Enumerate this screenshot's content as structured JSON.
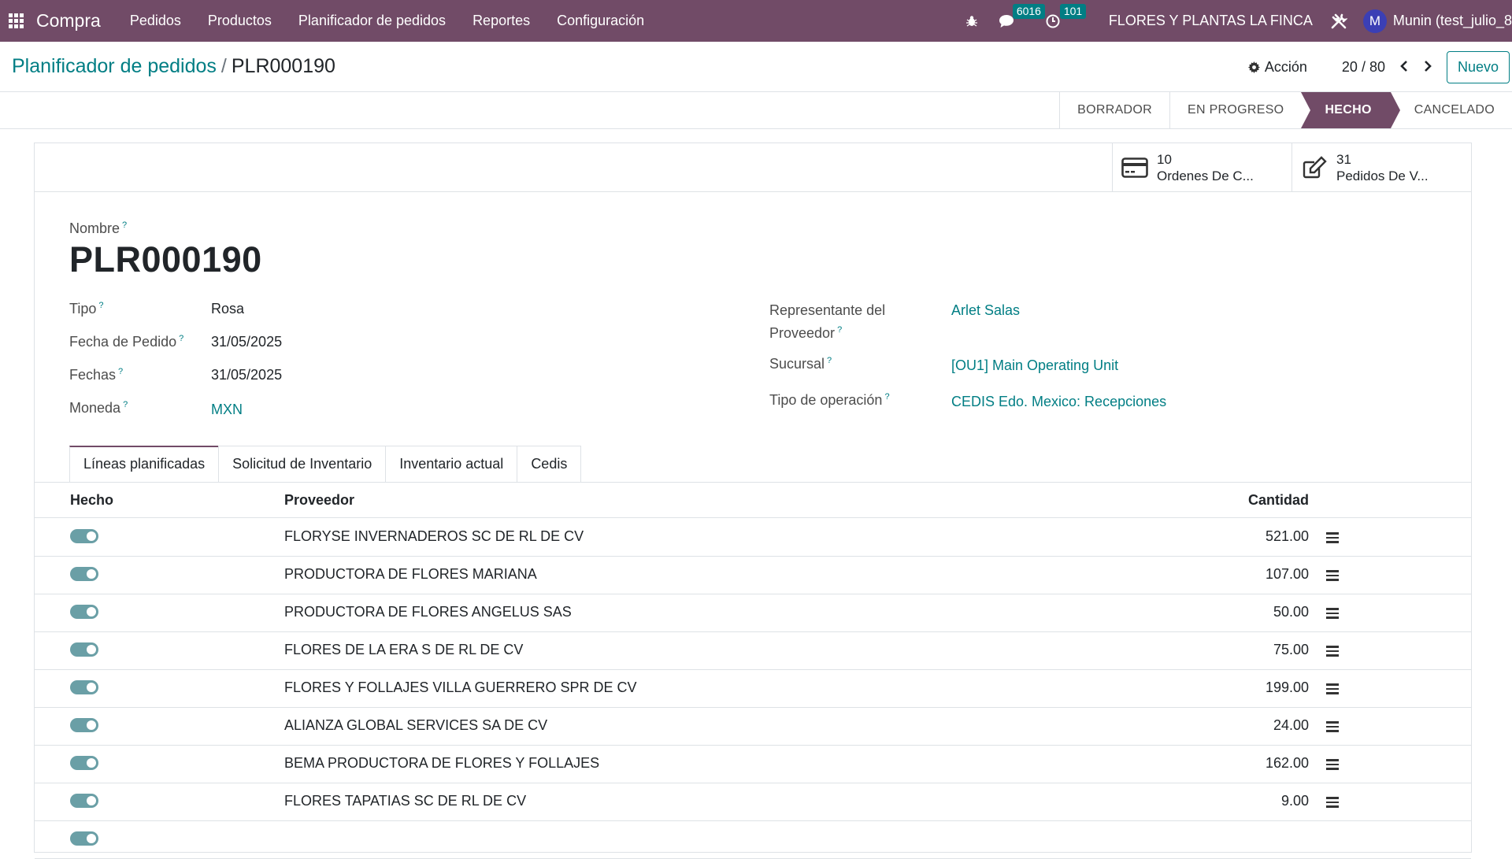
{
  "navbar": {
    "brand": "Compra",
    "menu": [
      "Pedidos",
      "Productos",
      "Planificador de pedidos",
      "Reportes",
      "Configuración"
    ],
    "messages_badge": "6016",
    "activities_badge": "101",
    "company": "FLORES Y PLANTAS LA FINCA",
    "avatar_initial": "M",
    "user": "Munin (test_julio_8"
  },
  "control_panel": {
    "breadcrumb_parent": "Planificador de pedidos",
    "breadcrumb_sep": "/",
    "breadcrumb_current": "PLR000190",
    "action_label": "Acción",
    "pager": "20 / 80",
    "new_label": "Nuevo"
  },
  "status": {
    "stages": [
      "BORRADOR",
      "EN PROGRESO",
      "HECHO",
      "CANCELADO"
    ],
    "active": "HECHO"
  },
  "smart_buttons": [
    {
      "count": "10",
      "label": "Ordenes De C..."
    },
    {
      "count": "31",
      "label": "Pedidos De V..."
    }
  ],
  "form": {
    "name_label": "Nombre",
    "name": "PLR000190",
    "tipo_label": "Tipo",
    "tipo": "Rosa",
    "fecha_pedido_label": "Fecha de Pedido",
    "fecha_pedido": "31/05/2025",
    "fechas_label": "Fechas",
    "fechas": "31/05/2025",
    "moneda_label": "Moneda",
    "moneda": "MXN",
    "representante_label_1": "Representante del",
    "representante_label_2": "Proveedor",
    "representante": "Arlet Salas",
    "sucursal_label": "Sucursal",
    "sucursal": "[OU1] Main Operating Unit",
    "tipo_operacion_label": "Tipo de operación",
    "tipo_operacion": "CEDIS Edo. Mexico: Recepciones",
    "help_mark": "?"
  },
  "tabs": [
    "Líneas planificadas",
    "Solicitud de Inventario",
    "Inventario actual",
    "Cedis"
  ],
  "table": {
    "headers": {
      "done": "Hecho",
      "supplier": "Proveedor",
      "qty": "Cantidad"
    },
    "rows": [
      {
        "supplier": "FLORYSE INVERNADEROS SC DE RL DE CV",
        "qty": "521.00",
        "done": true
      },
      {
        "supplier": "PRODUCTORA DE FLORES MARIANA",
        "qty": "107.00",
        "done": true
      },
      {
        "supplier": "PRODUCTORA DE FLORES ANGELUS SAS",
        "qty": "50.00",
        "done": true
      },
      {
        "supplier": "FLORES DE LA ERA S DE RL DE CV",
        "qty": "75.00",
        "done": true
      },
      {
        "supplier": "FLORES Y FOLLAJES VILLA GUERRERO SPR DE CV",
        "qty": "199.00",
        "done": true
      },
      {
        "supplier": "ALIANZA GLOBAL SERVICES SA DE CV",
        "qty": "24.00",
        "done": true
      },
      {
        "supplier": "BEMA PRODUCTORA DE FLORES Y FOLLAJES",
        "qty": "162.00",
        "done": true
      },
      {
        "supplier": "FLORES TAPATIAS SC DE RL DE CV",
        "qty": "9.00",
        "done": true
      }
    ]
  },
  "colors": {
    "brand": "#714b67",
    "accent": "#017e84",
    "toggle_on": "#6a9fa6"
  }
}
